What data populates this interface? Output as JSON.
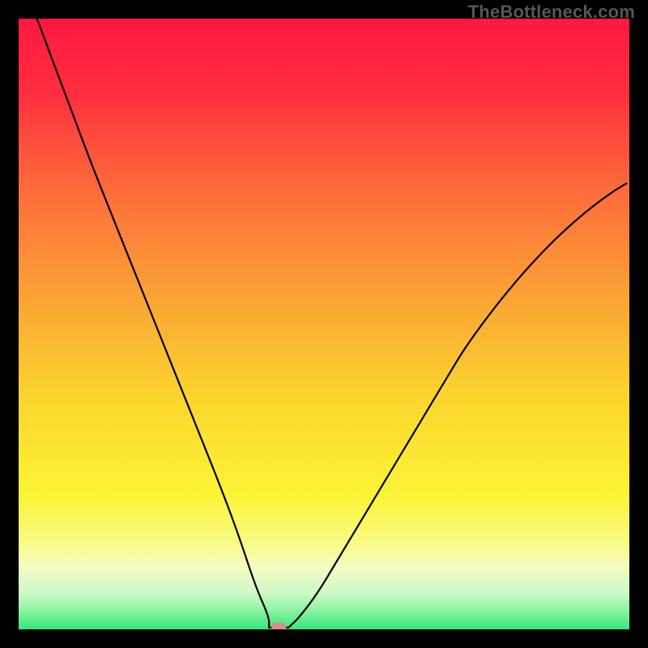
{
  "watermark": "TheBottleneck.com",
  "chart_data": {
    "type": "line",
    "title": "",
    "xlabel": "",
    "ylabel": "",
    "xlim": [
      0,
      100
    ],
    "ylim": [
      0,
      100
    ],
    "legend": false,
    "grid": false,
    "curve": {
      "name": "bottleneck-curve",
      "color": "#000000",
      "x": [
        3,
        6,
        9,
        12,
        15,
        18,
        21,
        24,
        27,
        30,
        33,
        36,
        38.8,
        41.0,
        43.5,
        46.0,
        49.0,
        52.0,
        55.0,
        58.0,
        61.0,
        64.0,
        67.0,
        70.0,
        73.0,
        77.0,
        81.0,
        85.0,
        89.0,
        93.0,
        97.0,
        99.5
      ],
      "y": [
        100,
        92,
        84,
        76,
        68.5,
        61,
        53.5,
        46,
        38.5,
        31,
        23.5,
        15.5,
        7.0,
        2.0,
        0.3,
        2.0,
        6.0,
        11.0,
        16.0,
        21.0,
        26.0,
        31.0,
        36.0,
        41.0,
        46.0,
        51.5,
        56.5,
        61.0,
        65.0,
        68.5,
        71.5,
        73.0
      ]
    },
    "flat_bottom": {
      "x_start": 41.0,
      "x_end": 44.2,
      "y": 0.3
    },
    "marker": {
      "x": 42.6,
      "y": 0.3,
      "width_pct": 2.4,
      "height_pct": 1.6,
      "color": "#dd8b8d"
    },
    "background_gradient": {
      "stops": [
        {
          "pos": 0.0,
          "color": "#fe183f"
        },
        {
          "pos": 0.12,
          "color": "#fe2e3f"
        },
        {
          "pos": 0.28,
          "color": "#fd6b3b"
        },
        {
          "pos": 0.45,
          "color": "#fba136"
        },
        {
          "pos": 0.62,
          "color": "#fbd52e"
        },
        {
          "pos": 0.78,
          "color": "#fbf435"
        },
        {
          "pos": 0.86,
          "color": "#fafc89"
        },
        {
          "pos": 0.9,
          "color": "#f4fbc5"
        },
        {
          "pos": 0.94,
          "color": "#cefac6"
        },
        {
          "pos": 0.97,
          "color": "#88f3a0"
        },
        {
          "pos": 1.0,
          "color": "#35e77a"
        }
      ]
    },
    "frame": {
      "color": "#000000",
      "thickness_px": 23
    }
  }
}
